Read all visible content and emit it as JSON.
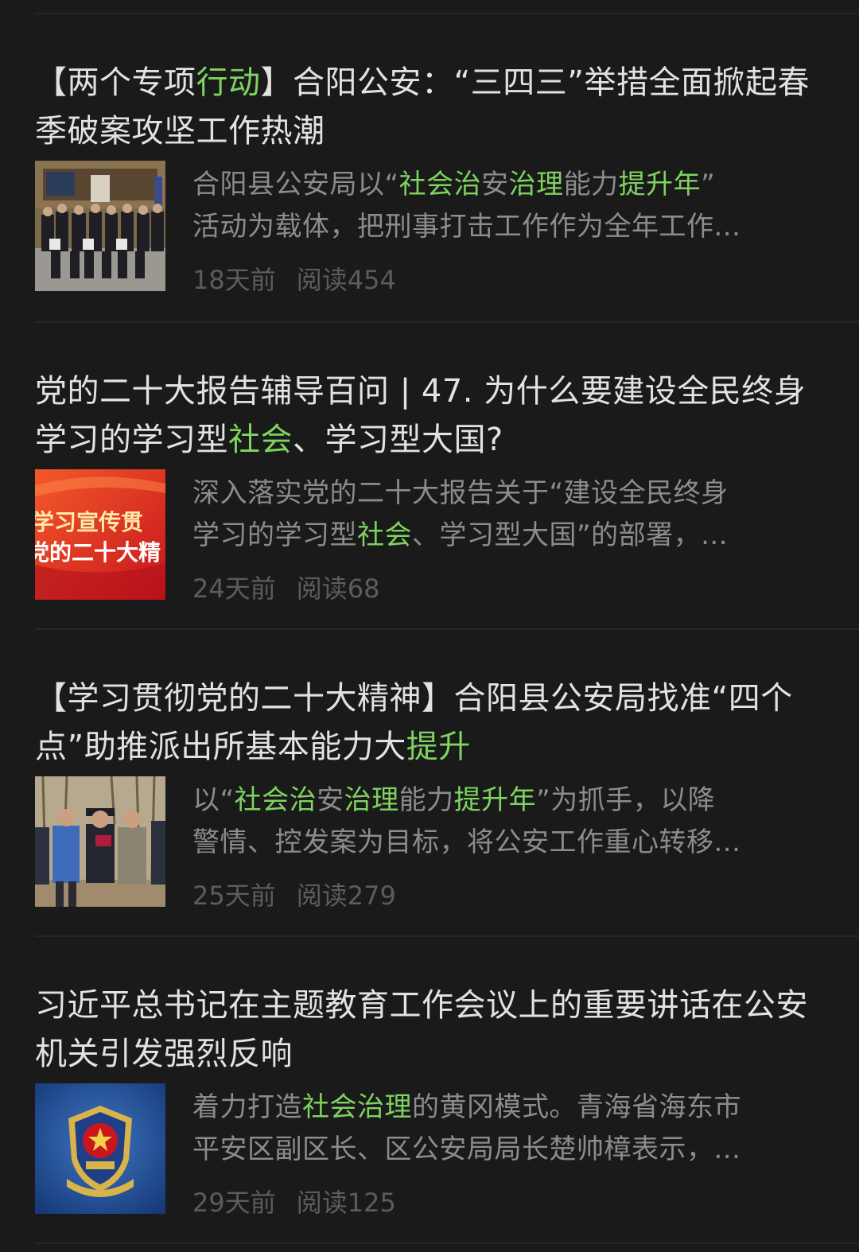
{
  "articles": [
    {
      "title_parts": [
        {
          "text": "【两个专项",
          "hl": false
        },
        {
          "text": "行动",
          "hl": true
        },
        {
          "text": "】合阳公安：“三四三”举措全面掀起春季破案攻坚工作热潮",
          "hl": false
        }
      ],
      "summary_lines": [
        [
          {
            "text": "合阳县公安局以“",
            "hl": false
          },
          {
            "text": "社会治",
            "hl": true
          },
          {
            "text": "安",
            "hl": false
          },
          {
            "text": "治理",
            "hl": true
          },
          {
            "text": "能力",
            "hl": false
          },
          {
            "text": "提升年",
            "hl": true
          },
          {
            "text": "”",
            "hl": false
          }
        ],
        [
          {
            "text": "活动为载体，把刑事打击工作作为全年工作...",
            "hl": false
          }
        ]
      ],
      "time": "18天前",
      "reads": "阅读454",
      "thumb": "police-group-photo"
    },
    {
      "title_parts": [
        {
          "text": "党的二十大报告辅导百问 | 47. 为什么要建设全民终身学习的学习型",
          "hl": false
        },
        {
          "text": "社会",
          "hl": true
        },
        {
          "text": "、学习型大国?",
          "hl": false
        }
      ],
      "summary_lines": [
        [
          {
            "text": "深入落实党的二十大报告关于“建设全民终身",
            "hl": false
          }
        ],
        [
          {
            "text": "学习的学习型",
            "hl": false
          },
          {
            "text": "社会",
            "hl": true
          },
          {
            "text": "、学习型大国”的部署，...",
            "hl": false
          }
        ]
      ],
      "time": "24天前",
      "reads": "阅读68",
      "thumb": "red-banner",
      "thumb_text": [
        "学习宣传贯",
        "党的二十大精"
      ]
    },
    {
      "title_parts": [
        {
          "text": "【学习贯彻党的二十大精神】合阳县公安局找准“四个点”助推派出所基本能力大",
          "hl": false
        },
        {
          "text": "提升",
          "hl": true
        }
      ],
      "summary_lines": [
        [
          {
            "text": "以“",
            "hl": false
          },
          {
            "text": "社会治",
            "hl": true
          },
          {
            "text": "安",
            "hl": false
          },
          {
            "text": "治理",
            "hl": true
          },
          {
            "text": "能力",
            "hl": false
          },
          {
            "text": "提升年",
            "hl": true
          },
          {
            "text": "”为抓手，以降",
            "hl": false
          }
        ],
        [
          {
            "text": "警情、控发案为目标，将公安工作重心转移...",
            "hl": false
          }
        ]
      ],
      "time": "25天前",
      "reads": "阅读279",
      "thumb": "field-officers-photo"
    },
    {
      "title_parts": [
        {
          "text": "习近平总书记在主题教育工作会议上的重要讲话在公安机关引发强烈反响",
          "hl": false
        }
      ],
      "summary_lines": [
        [
          {
            "text": "着力打造",
            "hl": false
          },
          {
            "text": "社会治理",
            "hl": true
          },
          {
            "text": "的黄冈模式。青海省海东市",
            "hl": false
          }
        ],
        [
          {
            "text": "平安区副区长、区公安局局长楚帅樟表示，...",
            "hl": false
          }
        ]
      ],
      "time": "29天前",
      "reads": "阅读125",
      "thumb": "police-emblem"
    }
  ]
}
